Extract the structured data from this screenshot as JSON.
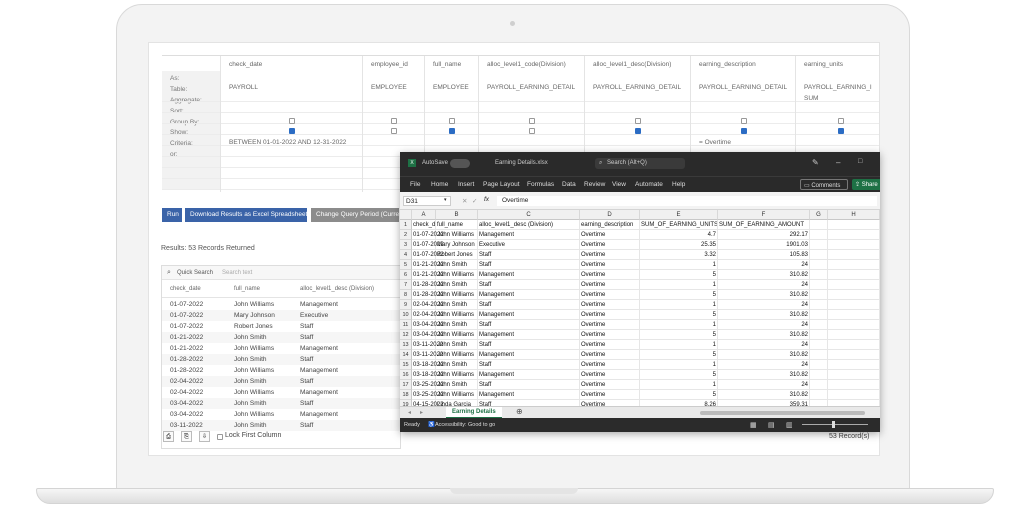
{
  "query_builder": {
    "row_labels": [
      "As:",
      "Table:",
      "Aggregate:",
      "Sort:",
      "Group By:",
      "Show:",
      "Criteria:",
      "or:"
    ],
    "columns": [
      {
        "field": "check_date",
        "table": "PAYROLL",
        "aggregate": "",
        "show": true,
        "criteria": "BETWEEN 01-01-2022 AND 12-31-2022"
      },
      {
        "field": "employee_id",
        "table": "EMPLOYEE",
        "aggregate": "",
        "show": false,
        "criteria": ""
      },
      {
        "field": "full_name",
        "table": "EMPLOYEE",
        "aggregate": "",
        "show": true,
        "criteria": ""
      },
      {
        "field": "alloc_level1_code(Division)",
        "table": "PAYROLL_EARNING_DETAIL",
        "aggregate": "",
        "show": false,
        "criteria": ""
      },
      {
        "field": "alloc_level1_desc(Division)",
        "table": "PAYROLL_EARNING_DETAIL",
        "aggregate": "",
        "show": true,
        "criteria": ""
      },
      {
        "field": "earning_description",
        "table": "PAYROLL_EARNING_DETAIL",
        "aggregate": "",
        "show": true,
        "criteria": "= Overtime"
      },
      {
        "field": "earning_units",
        "table": "PAYROLL_EARNING_I",
        "aggregate": "SUM",
        "show": true,
        "criteria": ""
      }
    ]
  },
  "buttons": {
    "run": "Run",
    "download": "Download Results as Excel Spreadsheet",
    "change_period": "Change Query Period (Curren"
  },
  "results": {
    "summary": "Results: 53 Records Returned",
    "quick_search_label": "Quick Search",
    "search_placeholder": "Search text",
    "headers": [
      "check_date",
      "full_name",
      "alloc_level1_desc (Division)"
    ],
    "rows": [
      [
        "01-07-2022",
        "John Williams",
        "Management"
      ],
      [
        "01-07-2022",
        "Mary Johnson",
        "Executive"
      ],
      [
        "01-07-2022",
        "Robert Jones",
        "Staff"
      ],
      [
        "01-21-2022",
        "John Smith",
        "Staff"
      ],
      [
        "01-21-2022",
        "John Williams",
        "Management"
      ],
      [
        "01-28-2022",
        "John Smith",
        "Staff"
      ],
      [
        "01-28-2022",
        "John Williams",
        "Management"
      ],
      [
        "02-04-2022",
        "John Smith",
        "Staff"
      ],
      [
        "02-04-2022",
        "John Williams",
        "Management"
      ],
      [
        "03-04-2022",
        "John Smith",
        "Staff"
      ],
      [
        "03-04-2022",
        "John Williams",
        "Management"
      ],
      [
        "03-11-2022",
        "John Smith",
        "Staff"
      ]
    ],
    "lock_first_column": "Lock First Column",
    "record_count": "53 Record(s)"
  },
  "excel": {
    "autosave": "AutoSave",
    "file_name": "Earning Details.xlsx",
    "search": "Search (Alt+Q)",
    "menu": [
      "File",
      "Home",
      "Insert",
      "Page Layout",
      "Formulas",
      "Data",
      "Review",
      "View",
      "Automate",
      "Help"
    ],
    "comments": "Comments",
    "share": "Share",
    "name_box": "D31",
    "formula_value": "Overtime",
    "fx": "fx",
    "col_letters": [
      "A",
      "B",
      "C",
      "D",
      "E",
      "F",
      "G",
      "H"
    ],
    "header_row": [
      "check_date",
      "full_name",
      "alloc_level1_desc (Division)",
      "earning_description",
      "SUM_OF_EARNING_UNITS",
      "SUM_OF_EARNING_AMOUNT"
    ],
    "rows": [
      [
        "01-07-2022",
        "John Williams",
        "Management",
        "Overtime",
        "4.7",
        "292.17"
      ],
      [
        "01-07-2022",
        "Mary Johnson",
        "Executive",
        "Overtime",
        "25.35",
        "1901.03"
      ],
      [
        "01-07-2022",
        "Robert Jones",
        "Staff",
        "Overtime",
        "3.32",
        "105.83"
      ],
      [
        "01-21-2022",
        "John Smith",
        "Staff",
        "Overtime",
        "1",
        "24"
      ],
      [
        "01-21-2022",
        "John Williams",
        "Management",
        "Overtime",
        "5",
        "310.82"
      ],
      [
        "01-28-2022",
        "John Smith",
        "Staff",
        "Overtime",
        "1",
        "24"
      ],
      [
        "01-28-2022",
        "John Williams",
        "Management",
        "Overtime",
        "5",
        "310.82"
      ],
      [
        "02-04-2022",
        "John Smith",
        "Staff",
        "Overtime",
        "1",
        "24"
      ],
      [
        "02-04-2022",
        "John Williams",
        "Management",
        "Overtime",
        "5",
        "310.82"
      ],
      [
        "03-04-2022",
        "John Smith",
        "Staff",
        "Overtime",
        "1",
        "24"
      ],
      [
        "03-04-2022",
        "John Williams",
        "Management",
        "Overtime",
        "5",
        "310.82"
      ],
      [
        "03-11-2022",
        "John Smith",
        "Staff",
        "Overtime",
        "1",
        "24"
      ],
      [
        "03-11-2022",
        "John Williams",
        "Management",
        "Overtime",
        "5",
        "310.82"
      ],
      [
        "03-18-2022",
        "John Smith",
        "Staff",
        "Overtime",
        "1",
        "24"
      ],
      [
        "03-18-2022",
        "John Williams",
        "Management",
        "Overtime",
        "5",
        "310.82"
      ],
      [
        "03-25-2022",
        "John Smith",
        "Staff",
        "Overtime",
        "1",
        "24"
      ],
      [
        "03-25-2022",
        "John Williams",
        "Management",
        "Overtime",
        "5",
        "310.82"
      ],
      [
        "04-15-2022",
        "Linda Garcia",
        "Staff",
        "Overtime",
        "8.26",
        "359.31"
      ]
    ],
    "sheet_tab": "Earning Details",
    "status_ready": "Ready",
    "accessibility": "Accessibility: Good to go"
  }
}
